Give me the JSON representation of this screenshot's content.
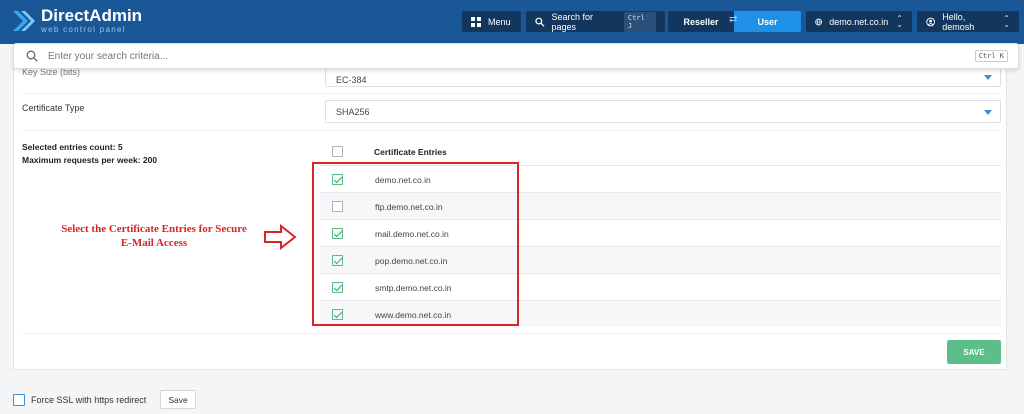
{
  "header": {
    "brand": "DirectAdmin",
    "brand_sub": "web control panel",
    "menu_label": "Menu",
    "search_label": "Search for pages",
    "search_shortcut": "Ctrl J",
    "role_reseller": "Reseller",
    "role_user": "User",
    "domain": "demo.net.co.in",
    "greeting": "Hello, demosh"
  },
  "search": {
    "placeholder": "Enter your search criteria...",
    "shortcut": "Ctrl K"
  },
  "form": {
    "key_size_label": "Key Size (bits)",
    "key_size_value": "EC-384",
    "cert_type_label": "Certificate Type",
    "cert_type_value": "SHA256",
    "selected_count_text": "Selected entries count: 5",
    "max_requests_text": "Maximum requests per week: 200",
    "entries_header": "Certificate Entries",
    "entries": [
      {
        "name": "demo.net.co.in",
        "checked": true
      },
      {
        "name": "ftp.demo.net.co.in",
        "checked": false
      },
      {
        "name": "mail.demo.net.co.in",
        "checked": true
      },
      {
        "name": "pop.demo.net.co.in",
        "checked": true
      },
      {
        "name": "smtp.demo.net.co.in",
        "checked": true
      },
      {
        "name": "www.demo.net.co.in",
        "checked": true
      }
    ],
    "save_label": "SAVE"
  },
  "annotation": {
    "line1": "Select the Certificate Entries for Secure",
    "line2": "E-Mail Access"
  },
  "footer": {
    "force_ssl_label": "Force SSL with https redirect",
    "save_label": "Save"
  },
  "colors": {
    "header_bg": "#1a5796",
    "accent": "#1e90e8",
    "success": "#5cbf8a",
    "annotation": "#d62626"
  }
}
